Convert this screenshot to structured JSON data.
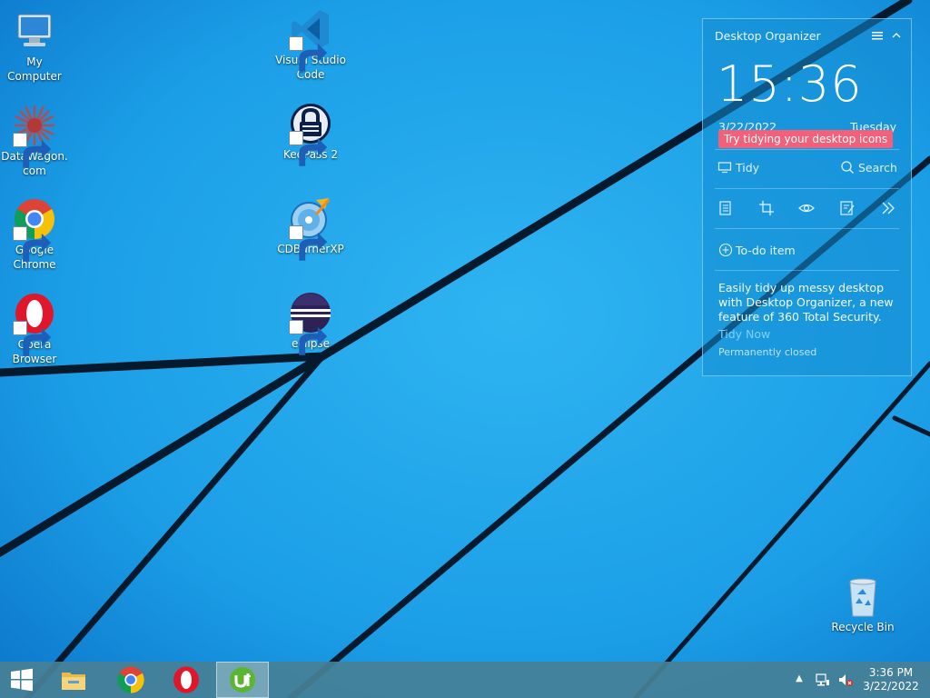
{
  "desktop": {
    "icons": [
      {
        "label": "My\nComputer"
      },
      {
        "label": "DataWagon.\ncom"
      },
      {
        "label": "Google\nChrome"
      },
      {
        "label": "Opera\nBrowser"
      },
      {
        "label": "Visual Studio\nCode"
      },
      {
        "label": "KeePass 2"
      },
      {
        "label": "CDBurnerXP"
      },
      {
        "label": "eclipse"
      },
      {
        "label": "Recycle Bin"
      }
    ]
  },
  "organizer": {
    "title": "Desktop Organizer",
    "clock": "15:36",
    "date": "3/22/2022",
    "day": "Tuesday",
    "tooltip": "Try tidying your desktop icons",
    "tidy_label": "Tidy",
    "search_label": "Search",
    "todo_label": "To-do item",
    "description": "Easily tidy up messy desktop with Desktop Organizer, a new feature of 360 Total Security.",
    "tidy_now": "Tidy Now",
    "permanently_closed": "Permanently closed"
  },
  "taskbar": {
    "items": [
      "windows-start",
      "file-explorer",
      "google-chrome",
      "opera",
      "utorrent"
    ],
    "clock_time": "3:36 PM",
    "clock_date": "3/22/2022"
  },
  "colors": {
    "wallpaper": "#1fa4ea",
    "tooltip": "#f2607a",
    "link": "#7fd0ff"
  }
}
